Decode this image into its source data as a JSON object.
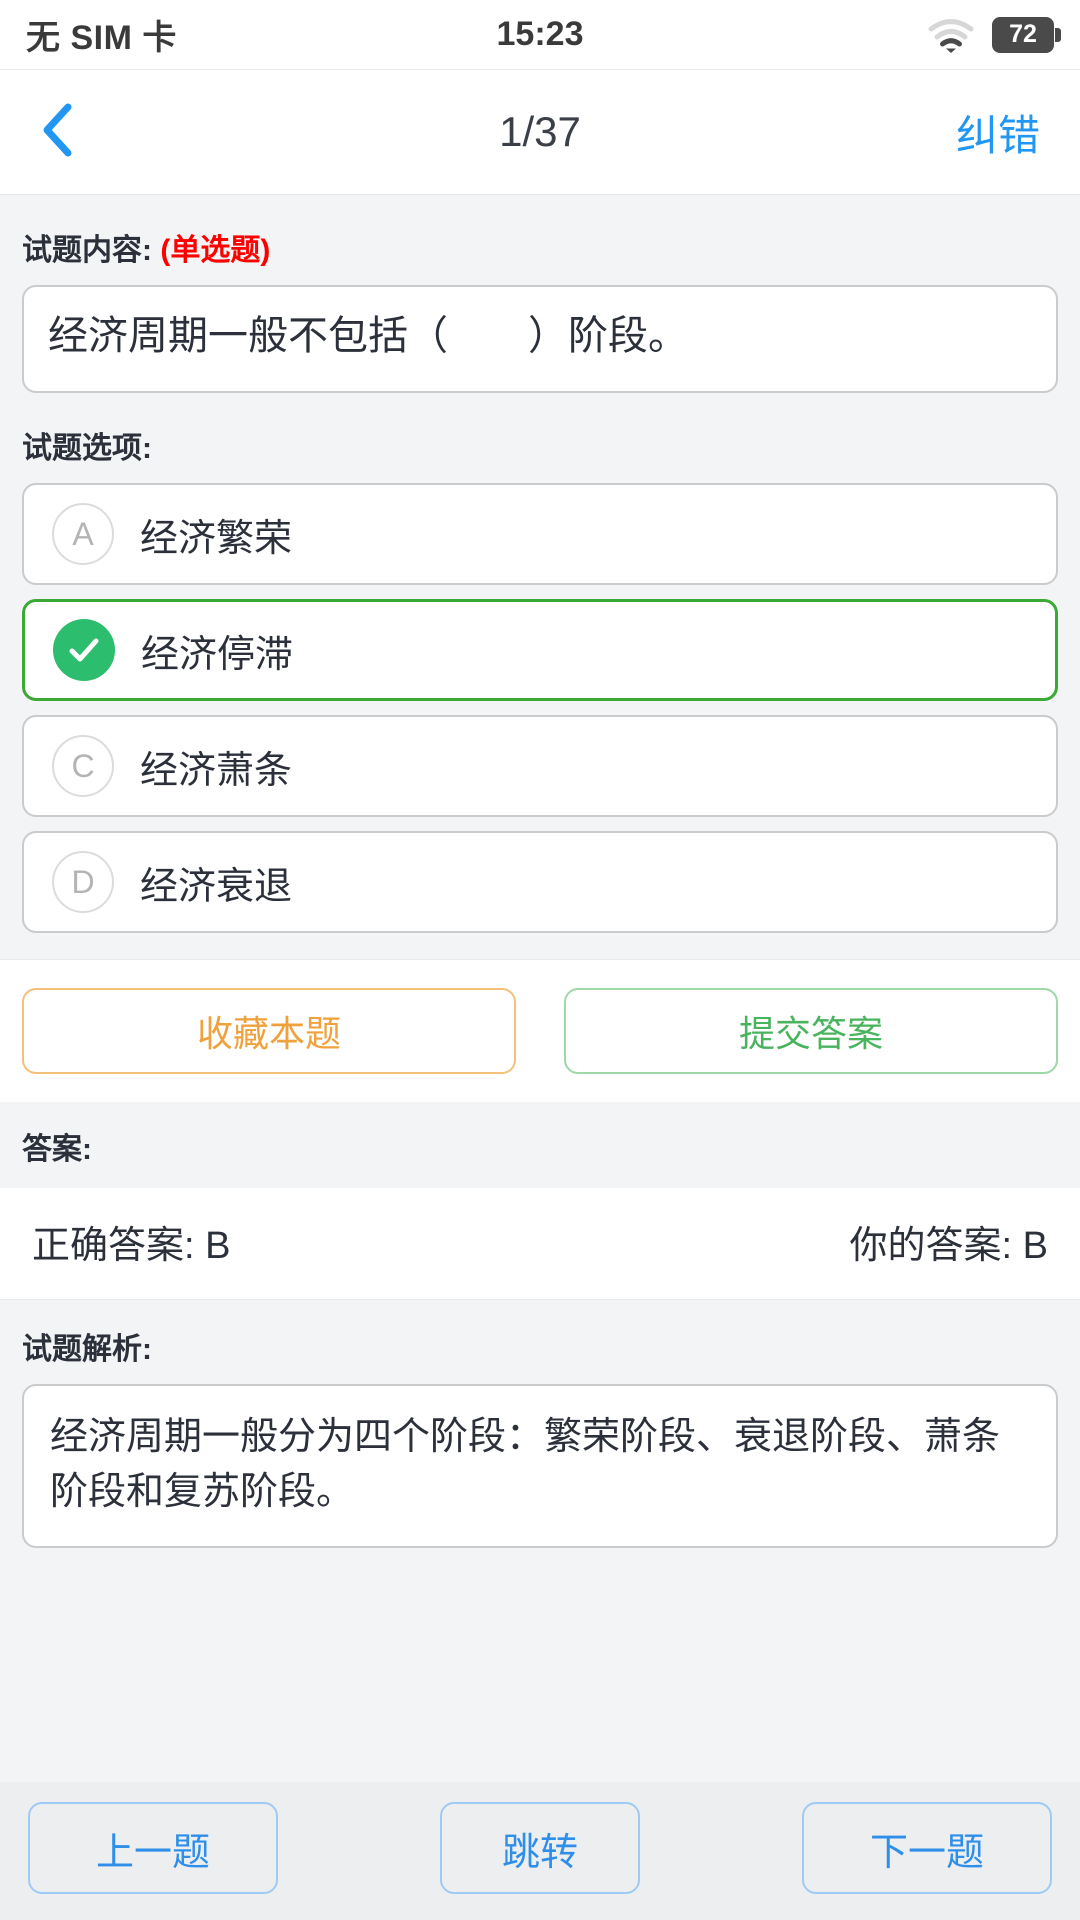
{
  "statusbar": {
    "carrier": "无 SIM 卡",
    "time": "15:23",
    "battery_level": "72",
    "wifi_icon": "wifi-icon",
    "battery_icon": "battery-icon"
  },
  "navbar": {
    "back_icon": "chevron-left-icon",
    "title": "1/37",
    "action_label": "纠错"
  },
  "question": {
    "section_label": "试题内容:",
    "type_tag": "(单选题)",
    "text": "经济周期一般不包括（　　）阶段。"
  },
  "options": {
    "section_label": "试题选项:",
    "items": [
      {
        "badge": "A",
        "text": "经济繁荣",
        "selected": false
      },
      {
        "badge": "B",
        "text": "经济停滞",
        "selected": true
      },
      {
        "badge": "C",
        "text": "经济萧条",
        "selected": false
      },
      {
        "badge": "D",
        "text": "经济衰退",
        "selected": false
      }
    ]
  },
  "actions": {
    "collect_label": "收藏本题",
    "submit_label": "提交答案"
  },
  "answer": {
    "section_label": "答案:",
    "correct_label": "正确答案: B",
    "your_label": "你的答案: B"
  },
  "analysis": {
    "section_label": "试题解析:",
    "text": "经济周期一般分为四个阶段：繁荣阶段、衰退阶段、萧条阶段和复苏阶段。"
  },
  "bottom_nav": {
    "prev_label": "上一题",
    "jump_label": "跳转",
    "next_label": "下一题"
  },
  "colors": {
    "accent_blue": "#2196f3",
    "selected_green": "#2dbd6e",
    "selected_border": "#3aaa35",
    "tag_red": "#fe0000",
    "collect_orange": "#f0a13c",
    "submit_green": "#49b35e",
    "nav_blue": "#2f8fe8",
    "page_bg": "#f2f4f5"
  }
}
